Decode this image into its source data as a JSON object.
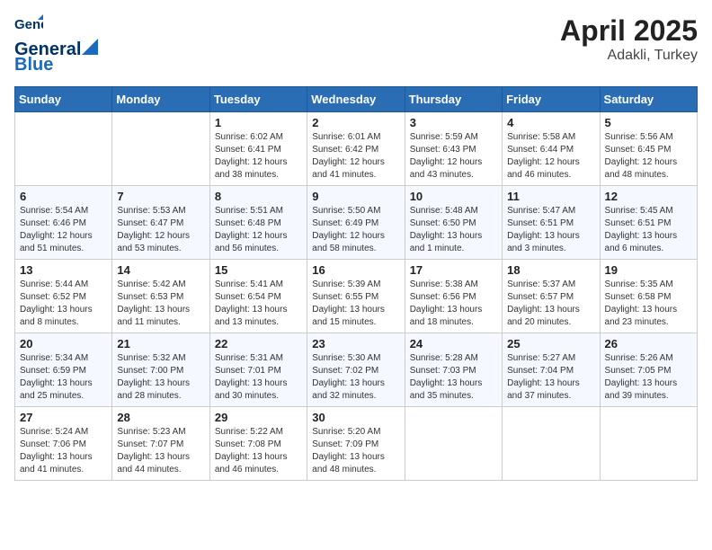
{
  "header": {
    "logo_line1": "General",
    "logo_line2": "Blue",
    "month_year": "April 2025",
    "location": "Adakli, Turkey"
  },
  "weekdays": [
    "Sunday",
    "Monday",
    "Tuesday",
    "Wednesday",
    "Thursday",
    "Friday",
    "Saturday"
  ],
  "weeks": [
    [
      {
        "day": "",
        "info": ""
      },
      {
        "day": "",
        "info": ""
      },
      {
        "day": "1",
        "info": "Sunrise: 6:02 AM\nSunset: 6:41 PM\nDaylight: 12 hours\nand 38 minutes."
      },
      {
        "day": "2",
        "info": "Sunrise: 6:01 AM\nSunset: 6:42 PM\nDaylight: 12 hours\nand 41 minutes."
      },
      {
        "day": "3",
        "info": "Sunrise: 5:59 AM\nSunset: 6:43 PM\nDaylight: 12 hours\nand 43 minutes."
      },
      {
        "day": "4",
        "info": "Sunrise: 5:58 AM\nSunset: 6:44 PM\nDaylight: 12 hours\nand 46 minutes."
      },
      {
        "day": "5",
        "info": "Sunrise: 5:56 AM\nSunset: 6:45 PM\nDaylight: 12 hours\nand 48 minutes."
      }
    ],
    [
      {
        "day": "6",
        "info": "Sunrise: 5:54 AM\nSunset: 6:46 PM\nDaylight: 12 hours\nand 51 minutes."
      },
      {
        "day": "7",
        "info": "Sunrise: 5:53 AM\nSunset: 6:47 PM\nDaylight: 12 hours\nand 53 minutes."
      },
      {
        "day": "8",
        "info": "Sunrise: 5:51 AM\nSunset: 6:48 PM\nDaylight: 12 hours\nand 56 minutes."
      },
      {
        "day": "9",
        "info": "Sunrise: 5:50 AM\nSunset: 6:49 PM\nDaylight: 12 hours\nand 58 minutes."
      },
      {
        "day": "10",
        "info": "Sunrise: 5:48 AM\nSunset: 6:50 PM\nDaylight: 13 hours\nand 1 minute."
      },
      {
        "day": "11",
        "info": "Sunrise: 5:47 AM\nSunset: 6:51 PM\nDaylight: 13 hours\nand 3 minutes."
      },
      {
        "day": "12",
        "info": "Sunrise: 5:45 AM\nSunset: 6:51 PM\nDaylight: 13 hours\nand 6 minutes."
      }
    ],
    [
      {
        "day": "13",
        "info": "Sunrise: 5:44 AM\nSunset: 6:52 PM\nDaylight: 13 hours\nand 8 minutes."
      },
      {
        "day": "14",
        "info": "Sunrise: 5:42 AM\nSunset: 6:53 PM\nDaylight: 13 hours\nand 11 minutes."
      },
      {
        "day": "15",
        "info": "Sunrise: 5:41 AM\nSunset: 6:54 PM\nDaylight: 13 hours\nand 13 minutes."
      },
      {
        "day": "16",
        "info": "Sunrise: 5:39 AM\nSunset: 6:55 PM\nDaylight: 13 hours\nand 15 minutes."
      },
      {
        "day": "17",
        "info": "Sunrise: 5:38 AM\nSunset: 6:56 PM\nDaylight: 13 hours\nand 18 minutes."
      },
      {
        "day": "18",
        "info": "Sunrise: 5:37 AM\nSunset: 6:57 PM\nDaylight: 13 hours\nand 20 minutes."
      },
      {
        "day": "19",
        "info": "Sunrise: 5:35 AM\nSunset: 6:58 PM\nDaylight: 13 hours\nand 23 minutes."
      }
    ],
    [
      {
        "day": "20",
        "info": "Sunrise: 5:34 AM\nSunset: 6:59 PM\nDaylight: 13 hours\nand 25 minutes."
      },
      {
        "day": "21",
        "info": "Sunrise: 5:32 AM\nSunset: 7:00 PM\nDaylight: 13 hours\nand 28 minutes."
      },
      {
        "day": "22",
        "info": "Sunrise: 5:31 AM\nSunset: 7:01 PM\nDaylight: 13 hours\nand 30 minutes."
      },
      {
        "day": "23",
        "info": "Sunrise: 5:30 AM\nSunset: 7:02 PM\nDaylight: 13 hours\nand 32 minutes."
      },
      {
        "day": "24",
        "info": "Sunrise: 5:28 AM\nSunset: 7:03 PM\nDaylight: 13 hours\nand 35 minutes."
      },
      {
        "day": "25",
        "info": "Sunrise: 5:27 AM\nSunset: 7:04 PM\nDaylight: 13 hours\nand 37 minutes."
      },
      {
        "day": "26",
        "info": "Sunrise: 5:26 AM\nSunset: 7:05 PM\nDaylight: 13 hours\nand 39 minutes."
      }
    ],
    [
      {
        "day": "27",
        "info": "Sunrise: 5:24 AM\nSunset: 7:06 PM\nDaylight: 13 hours\nand 41 minutes."
      },
      {
        "day": "28",
        "info": "Sunrise: 5:23 AM\nSunset: 7:07 PM\nDaylight: 13 hours\nand 44 minutes."
      },
      {
        "day": "29",
        "info": "Sunrise: 5:22 AM\nSunset: 7:08 PM\nDaylight: 13 hours\nand 46 minutes."
      },
      {
        "day": "30",
        "info": "Sunrise: 5:20 AM\nSunset: 7:09 PM\nDaylight: 13 hours\nand 48 minutes."
      },
      {
        "day": "",
        "info": ""
      },
      {
        "day": "",
        "info": ""
      },
      {
        "day": "",
        "info": ""
      }
    ]
  ]
}
